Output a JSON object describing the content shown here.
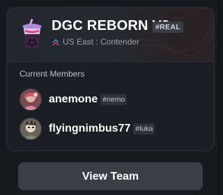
{
  "team": {
    "name": "DGC REBORN V3",
    "tag": "#REAL",
    "region": "US East : Contender",
    "logo_icon": "boba-cup-logo-icon",
    "region_icon": "rank-chevron-icon"
  },
  "members": {
    "label": "Current Members",
    "list": [
      {
        "name": "anemone",
        "tag": "#nemo",
        "avatar_icon": "avatar-anemone"
      },
      {
        "name": "flyingnimbus77",
        "tag": "#luka",
        "avatar_icon": "avatar-flyingnimbus77"
      }
    ]
  },
  "actions": {
    "view_team_label": "View Team"
  },
  "colors": {
    "background": "#16191e",
    "panel": "#1b1f25",
    "button": "#3a3f47",
    "text_primary": "#ffffff",
    "text_secondary": "#9aa1ab"
  }
}
